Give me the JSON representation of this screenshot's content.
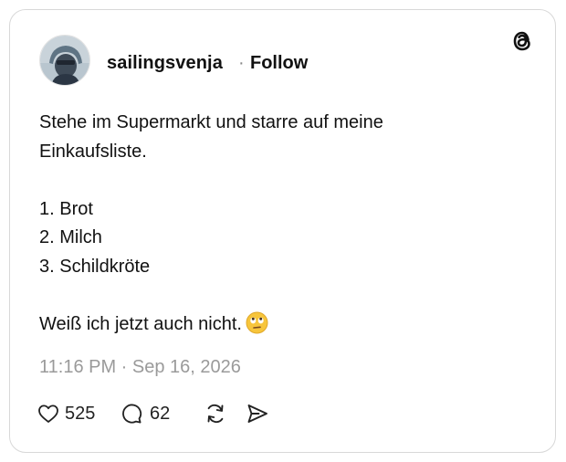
{
  "post": {
    "username": "sailingsvenja",
    "separator": "·",
    "follow_label": "Follow",
    "lines": [
      "Stehe im Supermarkt und starre auf meine",
      "Einkaufsliste.",
      "1. Brot",
      "2. Milch",
      "3. Schildkröte",
      "Weiß ich jetzt auch nicht."
    ],
    "emoji": "🙄",
    "timestamp": "11:16 PM · Sep 16, 2026"
  },
  "actions": {
    "likes": "525",
    "replies": "62"
  },
  "icons": {
    "brand": "threads-logo-icon",
    "like": "heart-icon",
    "reply": "comment-bubble-icon",
    "repost": "repost-icon",
    "share": "send-icon"
  }
}
